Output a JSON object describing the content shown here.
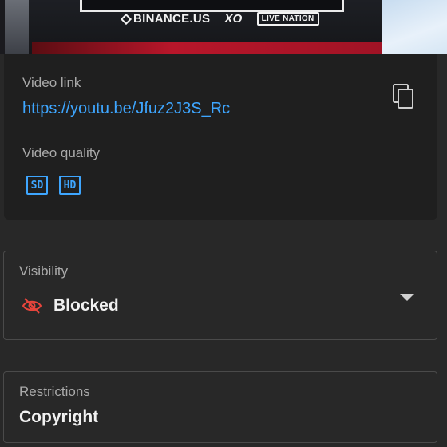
{
  "thumbnail": {
    "logos": {
      "binance": "BINANCE.US",
      "xo": "XO",
      "live_nation": "LIVE NATION"
    }
  },
  "details": {
    "link_label": "Video link",
    "link_url": "https://youtu.be/Jfuz2J3S_Rc",
    "quality_label": "Video quality",
    "quality_badges": [
      "SD",
      "HD"
    ]
  },
  "visibility": {
    "label": "Visibility",
    "value": "Blocked",
    "icon": "eye-off-icon",
    "icon_color": "#e8453c"
  },
  "restrictions": {
    "label": "Restrictions",
    "value": "Copyright"
  },
  "colors": {
    "link": "#3ea6ff",
    "background": "#282828",
    "card": "#1f1f1f"
  }
}
